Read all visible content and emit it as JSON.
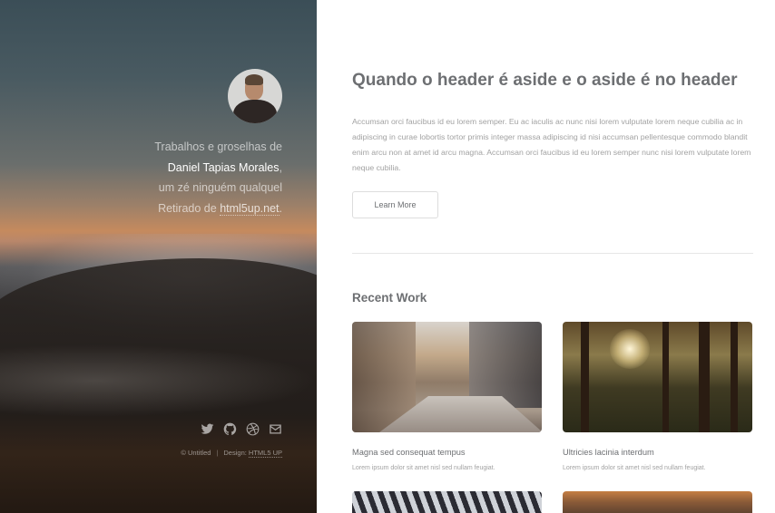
{
  "header": {
    "intro": {
      "line1": "Trabalhos e groselhas de",
      "name": "Daniel Tapias Morales",
      "name_suffix": ",",
      "line3": "um zé ninguém qualquel",
      "line4_prefix": "Retirado de ",
      "line4_link": "html5up.net",
      "line4_suffix": "."
    },
    "social_icons": [
      "twitter-icon",
      "github-icon",
      "dribbble-icon",
      "envelope-icon"
    ],
    "copyright": {
      "text": "© Untitled",
      "separator": "|",
      "credit_prefix": "Design: ",
      "credit_link": "HTML5 UP"
    }
  },
  "main": {
    "title": "Quando o header é aside e o aside é no header",
    "paragraph": "Accumsan orci faucibus id eu lorem semper. Eu ac iaculis ac nunc nisi lorem vulputate lorem neque cubilia ac in adipiscing in curae lobortis tortor primis integer massa adipiscing id nisi accumsan pellentesque commodo blandit enim arcu non at amet id arcu magna. Accumsan orci faucibus id eu lorem semper nunc nisi lorem vulputate lorem neque cubilia.",
    "button_label": "Learn More",
    "section_title": "Recent Work",
    "works": [
      {
        "title": "Magna sed consequat tempus",
        "text": "Lorem ipsum dolor sit amet nisl sed nullam feugiat."
      },
      {
        "title": "Ultricies lacinia interdum",
        "text": "Lorem ipsum dolor sit amet nisl sed nullam feugiat."
      }
    ]
  }
}
